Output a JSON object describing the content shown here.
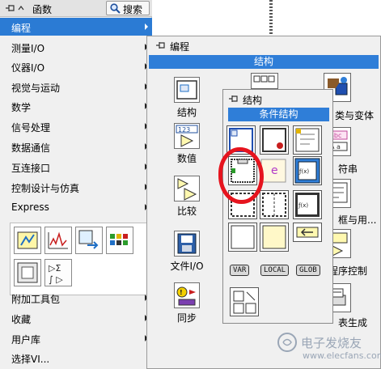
{
  "palette": {
    "title": "函数",
    "search_label": "搜索",
    "items": [
      {
        "label": "编程",
        "selected": true
      },
      {
        "label": "测量I/O"
      },
      {
        "label": "仪器I/O"
      },
      {
        "label": "视觉与运动"
      },
      {
        "label": "数学"
      },
      {
        "label": "信号处理"
      },
      {
        "label": "数据通信"
      },
      {
        "label": "互连接口"
      },
      {
        "label": "控制设计与仿真"
      },
      {
        "label": "Express"
      },
      {
        "label": "附加工具包"
      },
      {
        "label": "收藏"
      },
      {
        "label": "用户库"
      },
      {
        "label": "选择VI..."
      }
    ]
  },
  "programming": {
    "title": "编程",
    "band": "结构",
    "categories": [
      {
        "label": "结构"
      },
      {
        "label": "数值"
      },
      {
        "label": "比较"
      },
      {
        "label": "文件I/O"
      },
      {
        "label": "同步"
      }
    ],
    "right_fragments": [
      "类与变体",
      "符串",
      "框与用...",
      "程序控制",
      "表生成"
    ]
  },
  "structures": {
    "title": "结构",
    "band": "条件结构",
    "badges": [
      "VAR",
      "LOCAL",
      "GLOB"
    ]
  },
  "watermark": {
    "text": "电子发烧友",
    "sub": "www.elecfans.com"
  },
  "colors": {
    "selection": "#2b7bd4",
    "band": "#2f7ed8",
    "highlight_circle": "#e6141e"
  }
}
